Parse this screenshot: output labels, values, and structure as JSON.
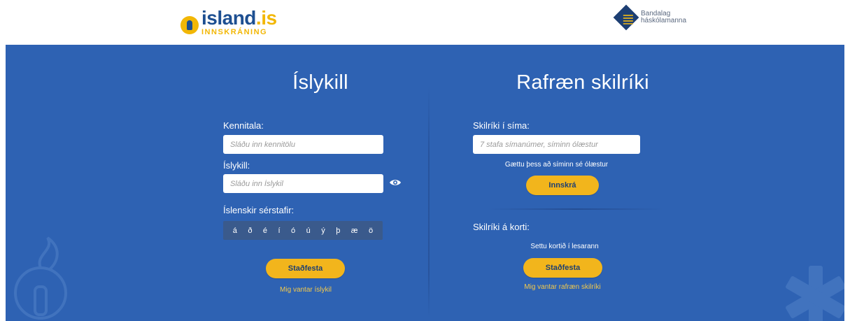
{
  "header": {
    "brand_name": "island",
    "brand_tld": ".is",
    "brand_sub": "INNSKRÁNING",
    "partner_line1": "Bandalag",
    "partner_line2": "háskólamanna"
  },
  "islykill": {
    "title": "Íslykill",
    "kennitala_label": "Kennitala:",
    "kennitala_placeholder": "Sláðu inn kennitölu",
    "islykill_label": "Íslykill:",
    "islykill_placeholder": "Sláðu inn Íslykil",
    "special_chars_label": "Íslenskir sérstafir:",
    "special_chars": [
      "á",
      "ð",
      "é",
      "í",
      "ó",
      "ú",
      "ý",
      "þ",
      "æ",
      "ö"
    ],
    "submit_label": "Staðfesta",
    "missing_link": "Mig vantar íslykil"
  },
  "rafraen": {
    "title": "Rafræn skilríki",
    "phone_label": "Skilríki í síma:",
    "phone_placeholder": "7 stafa símanúmer, síminn ólæstur",
    "phone_note": "Gættu þess að síminn sé ólæstur",
    "login_label": "Innskrá",
    "card_label": "Skilríki á korti:",
    "card_note": "Settu kortið í lesarann",
    "card_submit_label": "Staðfesta",
    "missing_link": "Mig vantar rafræn skilríki"
  },
  "icons": {
    "eye": "eye-icon",
    "logo_key": "key-icon",
    "logo_partner": "diamond-logo-icon"
  },
  "colors": {
    "main_bg": "#2e62b3",
    "accent": "#f2b51c",
    "brand_blue": "#1d4f91"
  }
}
